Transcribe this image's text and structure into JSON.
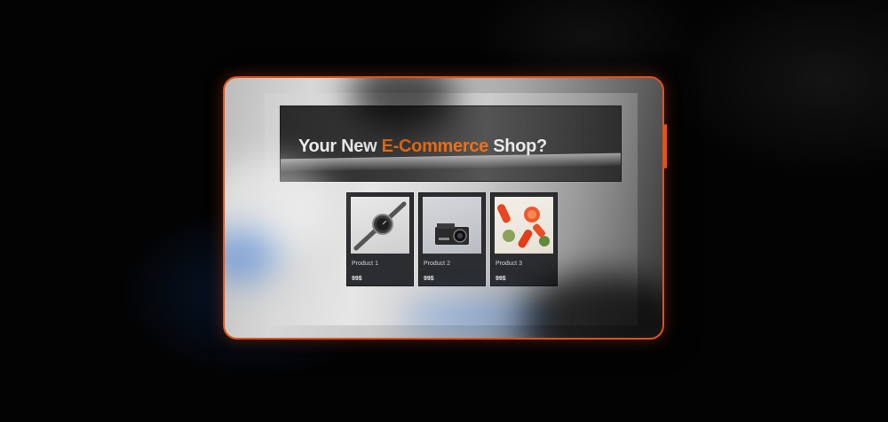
{
  "hero": {
    "title_prefix": "Your New ",
    "title_accent": "E-Commerce",
    "title_suffix": " Shop?"
  },
  "products": [
    {
      "name": "Product 1",
      "price": "99$",
      "image": "smartwatch-icon"
    },
    {
      "name": "Product 2",
      "price": "99$",
      "image": "camera-icon"
    },
    {
      "name": "Product 3",
      "price": "99$",
      "image": "fruit-icon"
    }
  ],
  "colors": {
    "accent": "#f07118",
    "frame": "#e0531a",
    "card_bg": "#2b2d30",
    "background": "#030303"
  }
}
